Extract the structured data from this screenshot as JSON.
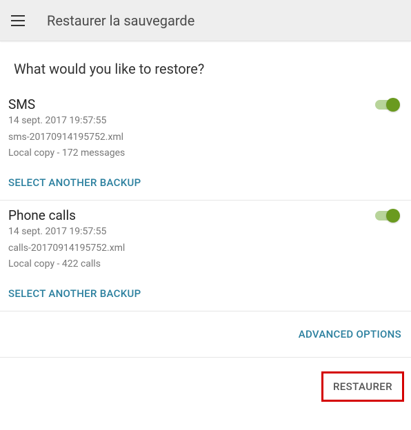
{
  "appbar": {
    "title": "Restaurer la sauvegarde"
  },
  "prompt": "What would you like to restore?",
  "sections": {
    "sms": {
      "title": "SMS",
      "date": "14 sept. 2017 19:57:55",
      "file": "sms-20170914195752.xml",
      "summary": "Local copy - 172 messages",
      "select_label": "SELECT ANOTHER BACKUP"
    },
    "calls": {
      "title": "Phone calls",
      "date": "14 sept. 2017 19:57:55",
      "file": "calls-20170914195752.xml",
      "summary": "Local copy - 422 calls",
      "select_label": "SELECT ANOTHER BACKUP"
    }
  },
  "advanced_label": "ADVANCED OPTIONS",
  "restore_label": "RESTAURER"
}
